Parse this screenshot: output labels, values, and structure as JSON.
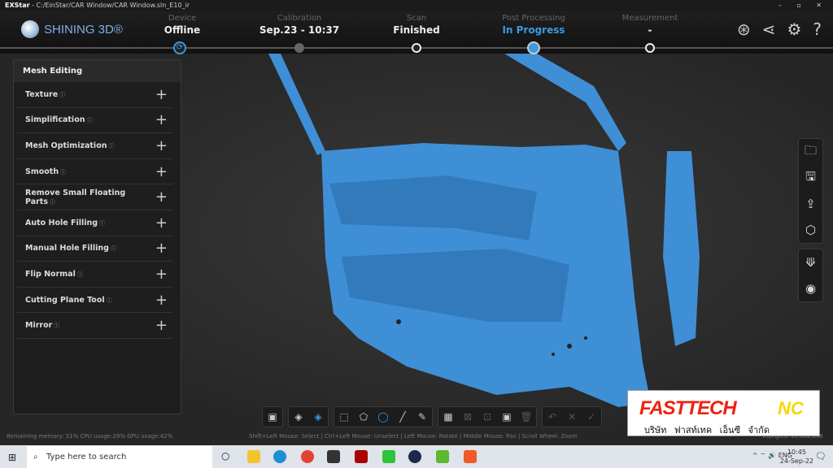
{
  "titlebar": {
    "app": "EXStar",
    "path": " - C:/EinStar/CAR Window/CAR Window.sln_E10_ir",
    "controls": "– ▫ ✕"
  },
  "header": {
    "logo": "SHINING 3D®",
    "steps": [
      {
        "label": "Device",
        "value": "Offline",
        "state": "active-sync"
      },
      {
        "label": "Calibration",
        "value": "Sep.23 - 10:37",
        "state": "done"
      },
      {
        "label": "Scan",
        "value": "Finished",
        "state": "done"
      },
      {
        "label": "Post Processing",
        "value": "In Progress",
        "state": "current"
      },
      {
        "label": "Measurement",
        "value": "-",
        "state": "pending"
      }
    ],
    "icons": [
      "new-feature-icon",
      "share-icon",
      "settings-icon",
      "help-icon"
    ],
    "accent": "#3b9ae0"
  },
  "panel": {
    "title": "Mesh Editing",
    "items": [
      {
        "label": "Texture"
      },
      {
        "label": "Simplification"
      },
      {
        "label": "Mesh Optimization"
      },
      {
        "label": "Smooth"
      },
      {
        "label": "Remove Small Floating Parts"
      },
      {
        "label": "Auto Hole Filling"
      },
      {
        "label": "Manual Hole Filling"
      },
      {
        "label": "Flip Normal"
      },
      {
        "label": "Cutting Plane Tool"
      },
      {
        "label": "Mirror"
      }
    ],
    "info_icon": "ⓘ",
    "expand_icon": "+"
  },
  "right_toolbar": [
    "folder-icon",
    "save-icon",
    "export-icon",
    "cube-view-icon",
    "fit-icon",
    "eye-icon"
  ],
  "status": {
    "left": "Remaining memory: 51% CPU usage:29%  GPU usage:42%",
    "center": "Shift+Left Mouse: Select | Ctrl+Left Mouse: Unselect | Left Mouse: Rotate | Middle Mouse: Pan | Scroll Wheel: Zoom",
    "right": "Triangles: 10,002,886"
  },
  "taskbar": {
    "search_placeholder": "Type here to search",
    "lang": "ENG",
    "time": "10:45",
    "date": "24-Sep-22"
  },
  "brand": {
    "name": "FASTTECH",
    "suffix": "NC",
    "thai": "บริษัท ฟาสท์เทค เอ็นซี จำกัด"
  },
  "mesh_color": "#3f8fd6"
}
